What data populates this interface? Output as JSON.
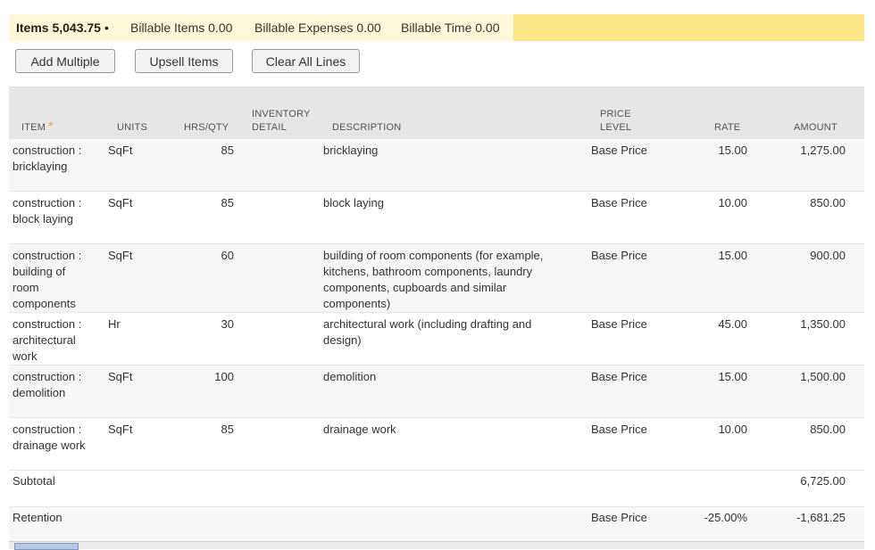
{
  "tabs": [
    {
      "label": "Items 5,043.75",
      "active": true,
      "dot": "•"
    },
    {
      "label": "Billable Items 0.00"
    },
    {
      "label": "Billable Expenses 0.00"
    },
    {
      "label": "Billable Time 0.00"
    }
  ],
  "buttons": {
    "add_multiple": "Add Multiple",
    "upsell_items": "Upsell Items",
    "clear_all_lines": "Clear All Lines"
  },
  "columns": {
    "item": "ITEM",
    "required_mark": "*",
    "units": "UNITS",
    "hrs_qty": "HRS/QTY",
    "inventory_detail_1": "INVENTORY",
    "inventory_detail_2": "DETAIL",
    "description": "DESCRIPTION",
    "price_level_1": "PRICE",
    "price_level_2": "LEVEL",
    "rate": "RATE",
    "amount": "AMOUNT"
  },
  "rows": [
    {
      "item": [
        "construction :",
        "bricklaying"
      ],
      "units": "SqFt",
      "qty": "85",
      "description": [
        "bricklaying"
      ],
      "price_level": "Base Price",
      "rate": "15.00",
      "amount": "1,275.00"
    },
    {
      "item": [
        "construction :",
        "block laying"
      ],
      "units": "SqFt",
      "qty": "85",
      "description": [
        "block laying"
      ],
      "price_level": "Base Price",
      "rate": "10.00",
      "amount": "850.00"
    },
    {
      "item": [
        "construction :",
        "building of",
        "room",
        "components"
      ],
      "units": "SqFt",
      "qty": "60",
      "description": [
        "building of room components (for example,",
        "kitchens, bathroom components, laundry",
        "components, cupboards and similar",
        "components)"
      ],
      "price_level": "Base Price",
      "rate": "15.00",
      "amount": "900.00"
    },
    {
      "item": [
        "construction :",
        "architectural",
        "work"
      ],
      "units": "Hr",
      "qty": "30",
      "description": [
        "architectural work (including drafting and",
        "design)"
      ],
      "price_level": "Base Price",
      "rate": "45.00",
      "amount": "1,350.00"
    },
    {
      "item": [
        "construction :",
        "demolition"
      ],
      "units": "SqFt",
      "qty": "100",
      "description": [
        "demolition"
      ],
      "price_level": "Base Price",
      "rate": "15.00",
      "amount": "1,500.00"
    },
    {
      "item": [
        "construction :",
        "drainage work"
      ],
      "units": "SqFt",
      "qty": "85",
      "description": [
        "drainage work"
      ],
      "price_level": "Base Price",
      "rate": "10.00",
      "amount": "850.00"
    }
  ],
  "subtotal": {
    "label": "Subtotal",
    "amount": "6,725.00"
  },
  "retention": {
    "label": "Retention",
    "price_level": "Base Price",
    "rate": "-25.00%",
    "amount": "-1,681.25"
  }
}
